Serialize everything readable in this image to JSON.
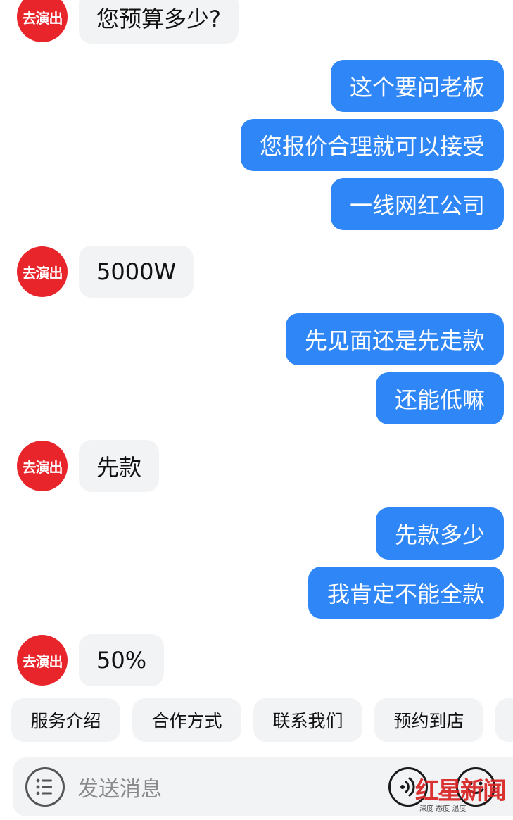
{
  "contact": {
    "avatar_text": "去演出"
  },
  "messages": {
    "m1": "您预算多少?",
    "m2": "这个要问老板",
    "m3": "您报价合理就可以接受",
    "m4": "一线网红公司",
    "m5": "5000W",
    "m6": "先见面还是先走款",
    "m7": "还能低嘛",
    "m8": "先款",
    "m9": "先款多少",
    "m10": "我肯定不能全款",
    "m11": "50%"
  },
  "quick_replies": [
    "服务介绍",
    "合作方式",
    "联系我们",
    "预约到店"
  ],
  "input": {
    "placeholder": "发送消息"
  },
  "watermark": {
    "logo": "红星新闻",
    "tagline": "深度 态度 温度"
  },
  "colors": {
    "outgoing_bubble": "#2f86f6",
    "incoming_bubble": "#f2f3f5",
    "avatar": "#e8252b"
  },
  "icons": {
    "menu": "menu-list-icon",
    "voice": "voice-icon",
    "emoji": "emoji-icon"
  }
}
